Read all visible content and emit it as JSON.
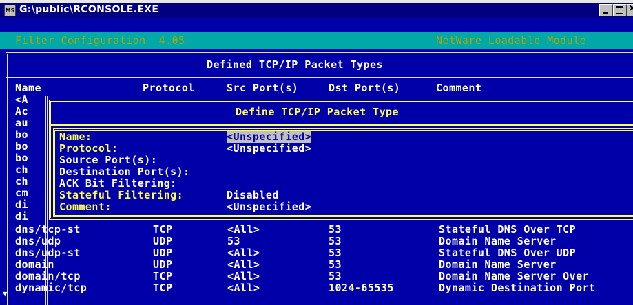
{
  "window": {
    "title": "G:\\public\\RCONSOLE.EXE",
    "icon": "ms-dos-icon",
    "icon_text": "MS"
  },
  "header": {
    "left": "Filter Configuration  4.05",
    "right": "NetWare Loadable Module"
  },
  "list": {
    "title": "Defined TCP/IP Packet Types",
    "columns": [
      "Name",
      "Protocol",
      "Src Port(s)",
      "Dst Port(s)",
      "Comment"
    ],
    "partial_names": [
      "<A",
      "Ac",
      "au",
      "bo",
      "bo",
      "bo",
      "ch",
      "ch",
      "cm",
      "di",
      "di"
    ],
    "rows": [
      {
        "name": "dns/tcp-st",
        "protocol": "TCP",
        "src": "<All>",
        "dst": "53",
        "comment": "Stateful DNS Over TCP"
      },
      {
        "name": "dns/udp",
        "protocol": "UDP",
        "src": "53",
        "dst": "53",
        "comment": "Domain Name Server"
      },
      {
        "name": "dns/udp-st",
        "protocol": "UDP",
        "src": "<All>",
        "dst": "53",
        "comment": "Stateful DNS Over UDP"
      },
      {
        "name": "domain",
        "protocol": "UDP",
        "src": "<All>",
        "dst": "53",
        "comment": "Domain Name Server"
      },
      {
        "name": "domain/tcp",
        "protocol": "TCP",
        "src": "<All>",
        "dst": "53",
        "comment": "Domain Name Server Over"
      },
      {
        "name": "dynamic/tcp",
        "protocol": "TCP",
        "src": "<All>",
        "dst": "1024-65535",
        "comment": "Dynamic Destination Port"
      }
    ],
    "scroll_indicator": "▼"
  },
  "dialog": {
    "title": "Define TCP/IP Packet Type",
    "fields": [
      {
        "label": "Name:",
        "value": "<Unspecified>",
        "highlight": true,
        "selected": true
      },
      {
        "label": "Protocol:",
        "value": "<Unspecified>",
        "highlight": true,
        "selected": false
      },
      {
        "label": "Source Port(s):",
        "value": "",
        "highlight": false,
        "selected": false
      },
      {
        "label": "Destination Port(s):",
        "value": "",
        "highlight": false,
        "selected": false
      },
      {
        "label": "ACK Bit Filtering:",
        "value": "",
        "highlight": false,
        "selected": false
      },
      {
        "label": "Stateful Filtering:",
        "value": "Disabled",
        "highlight": true,
        "selected": false
      },
      {
        "label": "Comment:",
        "value": "<Unspecified>",
        "highlight": true,
        "selected": false
      }
    ]
  },
  "colors": {
    "screen_bg": "#0000a8",
    "header_bg": "#00a8a8",
    "header_text": "#a8a800",
    "highlight_text": "#ffff55",
    "selection_bg": "#c0c0c0"
  }
}
